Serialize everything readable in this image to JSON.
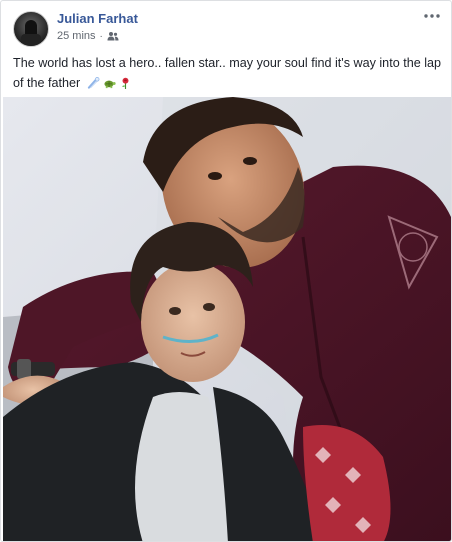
{
  "post": {
    "author": "Julian Farhat",
    "timestamp": "25 mins",
    "separator": "·",
    "audience_icon": "friends-icon",
    "more_icon": "ellipsis-icon",
    "text": "The world has lost a hero.. fallen star.. may your soul find it's way into the lap of the father",
    "emojis": [
      "shooting-star-emoji",
      "turtle-emoji",
      "rose-emoji"
    ],
    "photo": {
      "subject": "photo-two-people"
    }
  },
  "colors": {
    "author_link": "#385898",
    "meta_text": "#616770",
    "body_text": "#1d2129",
    "border": "#dddfe2"
  }
}
